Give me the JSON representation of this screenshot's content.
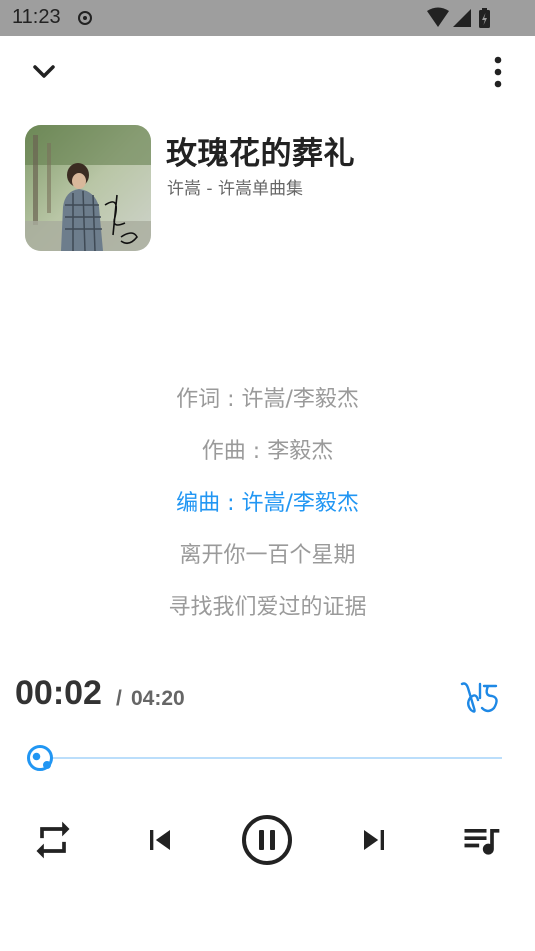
{
  "status_bar": {
    "time": "11:23",
    "icons": [
      "record-icon",
      "wifi-icon",
      "signal-icon",
      "battery-charging-icon"
    ]
  },
  "top_bar": {
    "collapse_icon": "chevron-down-icon",
    "menu_icon": "more-vertical-icon"
  },
  "song": {
    "title": "玫瑰花的葬礼",
    "subtitle": "许嵩 - 许嵩单曲集",
    "album_art": "album-cover"
  },
  "lyrics": {
    "lines": [
      {
        "text": "作词 : 许嵩/李毅杰",
        "active": false
      },
      {
        "text": "作曲 : 李毅杰",
        "active": false
      },
      {
        "text": "编曲 : 许嵩/李毅杰",
        "active": true
      },
      {
        "text": "离开你一百个星期",
        "active": false
      },
      {
        "text": "寻找我们爱过的证据",
        "active": false
      }
    ]
  },
  "playback": {
    "current_time": "00:02",
    "separator": "/",
    "total_time": "04:20",
    "progress": 0.008,
    "lyrics_toggle_icon": "lyrics-signature-icon"
  },
  "controls": {
    "repeat_icon": "repeat-icon",
    "previous_icon": "skip-previous-icon",
    "play_pause_icon": "pause-circle-icon",
    "next_icon": "skip-next-icon",
    "playlist_icon": "queue-music-icon"
  },
  "colors": {
    "accent": "#2196f3",
    "accent_light": "#bbdefb",
    "status_bar": "#9e9e9e",
    "lyric_inactive": "#9a9a9a",
    "text_primary": "#222222"
  }
}
